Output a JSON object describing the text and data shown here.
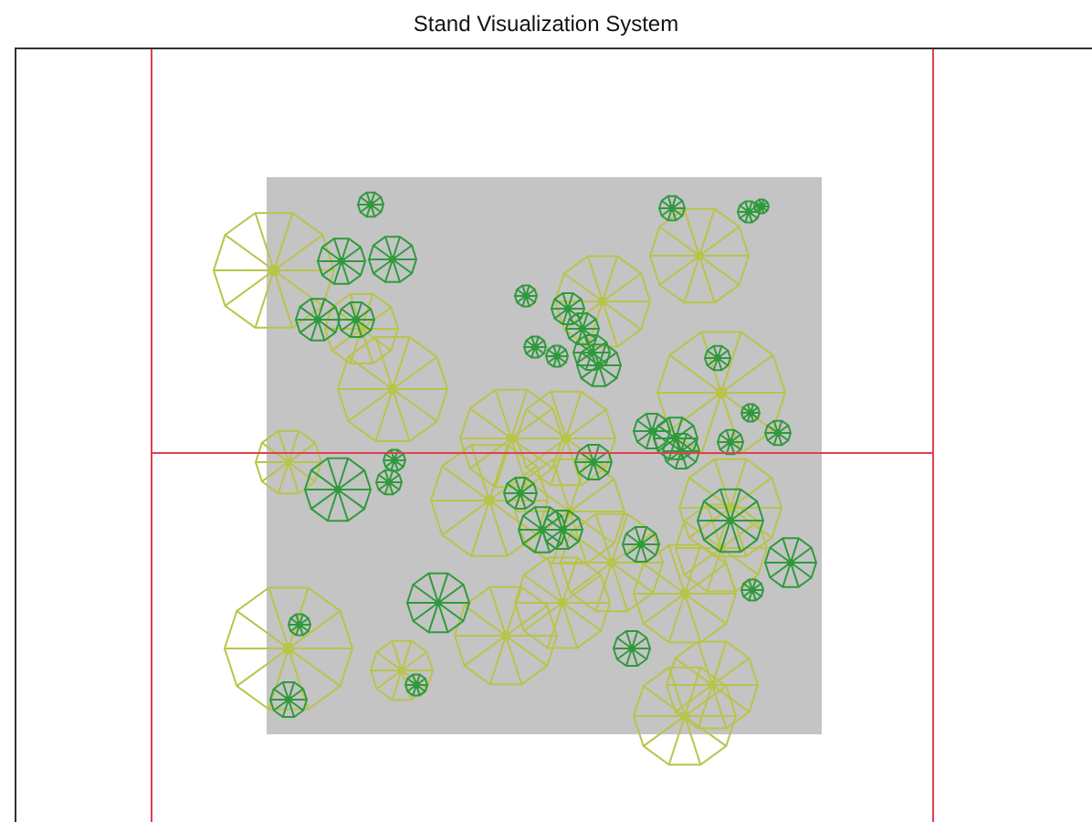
{
  "window": {
    "title": "Stand Visualization System"
  }
}
